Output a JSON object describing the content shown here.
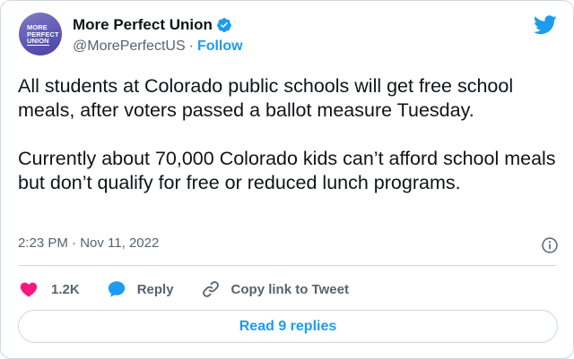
{
  "author": {
    "name": "More Perfect Union",
    "handle": "@MorePerfectUS",
    "separator": "·",
    "follow_label": "Follow",
    "avatar_logo_lines": [
      "MORE",
      "PERFECT",
      "UNION"
    ]
  },
  "tweet": {
    "paragraph1": "All students at Colorado public schools will get free school meals, after voters passed a ballot measure Tuesday.",
    "paragraph2": "Currently about 70,000 Colorado kids can’t afford school meals but don’t qualify for free or reduced lunch programs.",
    "timestamp": "2:23 PM · Nov 11, 2022"
  },
  "actions": {
    "likes_count": "1.2K",
    "reply_label": "Reply",
    "copy_link_label": "Copy link to Tweet"
  },
  "footer": {
    "read_replies_label": "Read 9 replies"
  },
  "icons": {
    "brand": "twitter-bird-icon",
    "verified": "verified-badge-icon",
    "info": "info-icon",
    "like": "heart-icon",
    "reply": "reply-bubble-icon",
    "copy": "link-icon"
  },
  "colors": {
    "accent": "#1d9bf0",
    "like": "#f91880",
    "text": "#0f1419",
    "muted": "#536471",
    "border": "#cfd9de",
    "avatar": "#5d56b3"
  }
}
